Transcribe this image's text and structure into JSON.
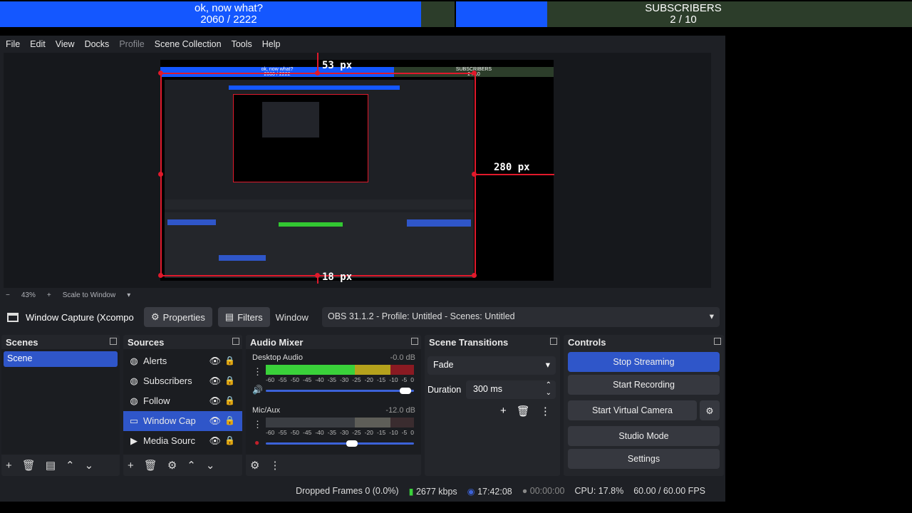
{
  "overlay": {
    "left_title": "ok, now what?",
    "left_count": "2060 / 2222",
    "left_progress": 0.927,
    "right_title": "SUBSCRIBERS",
    "right_count": "2 / 10",
    "right_progress": 0.2
  },
  "menu": [
    "File",
    "Edit",
    "View",
    "Docks",
    "Profile",
    "Scene Collection",
    "Tools",
    "Help"
  ],
  "preview": {
    "mini_left_title": "ok, now what?",
    "mini_left_count": "2060 / 2222",
    "mini_right_title": "SUBSCRIBERS",
    "mini_right_count": "2 / 10",
    "dim_top": "53 px",
    "dim_right": "280 px",
    "dim_bottom": "18 px"
  },
  "zoom": {
    "minus": "−",
    "level": "43%",
    "plus": "+",
    "mode": "Scale to Window"
  },
  "source_toolbar": {
    "source_name": "Window Capture (Xcompos",
    "properties": "Properties",
    "filters": "Filters",
    "window_label": "Window",
    "window_value": "OBS 31.1.2 - Profile: Untitled - Scenes: Untitled"
  },
  "scenes": {
    "title": "Scenes",
    "items": [
      "Scene"
    ]
  },
  "sources": {
    "title": "Sources",
    "items": [
      {
        "label": "Alerts",
        "icon": "globe-icon"
      },
      {
        "label": "Subscribers",
        "icon": "globe-icon"
      },
      {
        "label": "Follow",
        "icon": "globe-icon"
      },
      {
        "label": "Window Cap",
        "icon": "window-icon"
      },
      {
        "label": "Media Sourc",
        "icon": "play-icon"
      }
    ]
  },
  "mixer": {
    "title": "Audio Mixer",
    "channels": [
      {
        "name": "Desktop Audio",
        "db": "-0.0 dB",
        "volume": 0.96
      },
      {
        "name": "Mic/Aux",
        "db": "-12.0 dB",
        "volume": 0.6
      }
    ],
    "ticks": [
      "-60",
      "-55",
      "-50",
      "-45",
      "-40",
      "-35",
      "-30",
      "-25",
      "-20",
      "-15",
      "-10",
      "-5",
      "0"
    ]
  },
  "transitions": {
    "title": "Scene Transitions",
    "type": "Fade",
    "duration_label": "Duration",
    "duration_value": "300 ms"
  },
  "controls": {
    "title": "Controls",
    "stop_streaming": "Stop Streaming",
    "start_recording": "Start Recording",
    "start_virtual_camera": "Start Virtual Camera",
    "studio_mode": "Studio Mode",
    "settings": "Settings"
  },
  "status": {
    "dropped_frames": "Dropped Frames 0 (0.0%)",
    "bitrate": "2677 kbps",
    "stream_time": "17:42:08",
    "record_time": "00:00:00",
    "cpu": "CPU: 17.8%",
    "fps": "60.00 / 60.00 FPS"
  },
  "colors": {
    "accent": "#2f56c9",
    "goal_fill": "#1457ff",
    "goal_bg": "#2c3d2a",
    "selection": "#e0192b"
  }
}
